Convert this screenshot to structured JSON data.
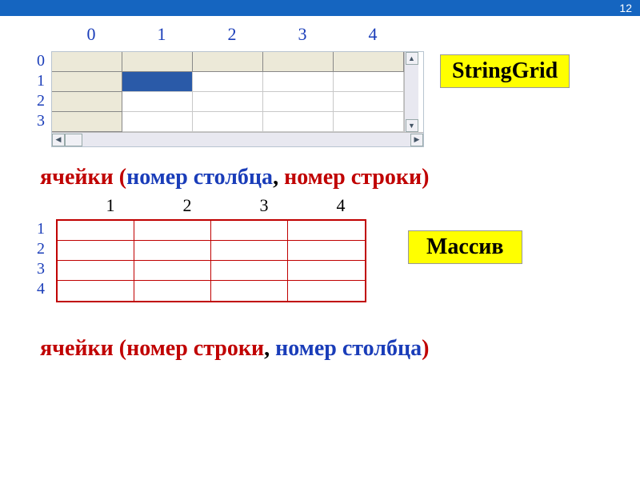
{
  "page_number": "12",
  "stringGrid": {
    "label": "StringGrid",
    "colHeaders": [
      "0",
      "1",
      "2",
      "3",
      "4"
    ],
    "rowHeaders": [
      "0",
      "1",
      "2",
      "3"
    ],
    "selected": {
      "row": 1,
      "col": 1
    }
  },
  "caption1": {
    "p1": "ячейки (",
    "p2": "номер столбца",
    "p3": ", ",
    "p4": "номер строки",
    "p5": ")"
  },
  "array": {
    "label": "Массив",
    "colHeaders": [
      "1",
      "2",
      "3",
      "4"
    ],
    "rowHeaders": [
      "1",
      "2",
      "3",
      "4"
    ]
  },
  "caption2": {
    "p1": "ячейки (",
    "p2": "номер строки",
    "p3": ", ",
    "p4": "номер столбца",
    "p5": ")"
  },
  "chart_data": [
    {
      "type": "table",
      "title": "StringGrid indexing",
      "cols": [
        0,
        1,
        2,
        3,
        4
      ],
      "rows": [
        0,
        1,
        2,
        3
      ],
      "index_order": "column, row",
      "selected_cell": [
        1,
        1
      ]
    },
    {
      "type": "table",
      "title": "Array indexing",
      "cols": [
        1,
        2,
        3,
        4
      ],
      "rows": [
        1,
        2,
        3,
        4
      ],
      "index_order": "row, column"
    }
  ]
}
